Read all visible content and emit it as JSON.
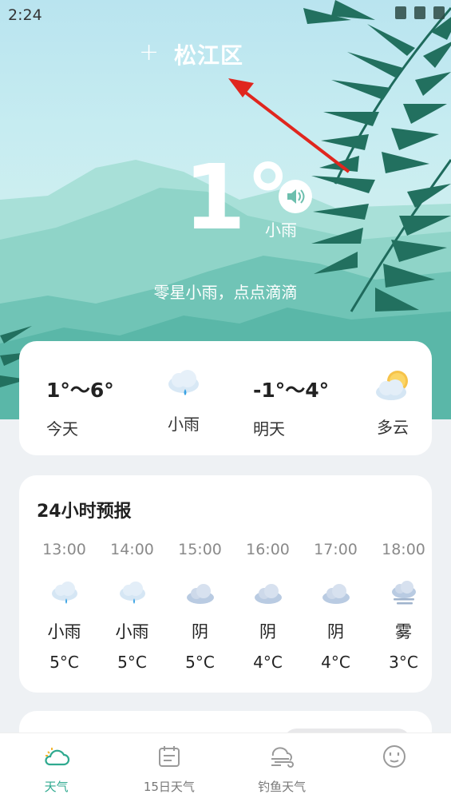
{
  "status_bar": {
    "time": "2:24"
  },
  "header": {
    "add_symbol": "+",
    "city": "松江区"
  },
  "current": {
    "temperature": "1°",
    "condition": "小雨",
    "summary": "零星小雨，点点滴滴"
  },
  "daily": [
    {
      "range": "1°～6°",
      "label": "今天",
      "condition": "小雨",
      "icon": "rain-cloud-icon"
    },
    {
      "range": "-1°～4°",
      "label": "明天",
      "condition": "多云",
      "icon": "partly-cloudy-icon"
    }
  ],
  "hourly": {
    "title": "24小时预报",
    "items": [
      {
        "time": "13:00",
        "condition": "小雨",
        "temp": "5°C",
        "icon": "rain-cloud-icon"
      },
      {
        "time": "14:00",
        "condition": "小雨",
        "temp": "5°C",
        "icon": "rain-cloud-icon"
      },
      {
        "time": "15:00",
        "condition": "阴",
        "temp": "5°C",
        "icon": "overcast-cloud-icon"
      },
      {
        "time": "16:00",
        "condition": "阴",
        "temp": "4°C",
        "icon": "overcast-cloud-icon"
      },
      {
        "time": "17:00",
        "condition": "阴",
        "temp": "4°C",
        "icon": "overcast-cloud-icon"
      },
      {
        "time": "18:00",
        "condition": "雾",
        "temp": "3°C",
        "icon": "fog-icon"
      }
    ]
  },
  "nav": [
    {
      "label": "天气",
      "active": true,
      "icon": "weather-cloud-icon"
    },
    {
      "label": "15日天气",
      "active": false,
      "icon": "calendar-icon"
    },
    {
      "label": "钓鱼天气",
      "active": false,
      "icon": "wind-icon"
    },
    {
      "label": "",
      "active": false,
      "icon": "face-icon"
    }
  ],
  "colors": {
    "accent": "#2fa98f",
    "rain_blue": "#3aa3e3"
  }
}
